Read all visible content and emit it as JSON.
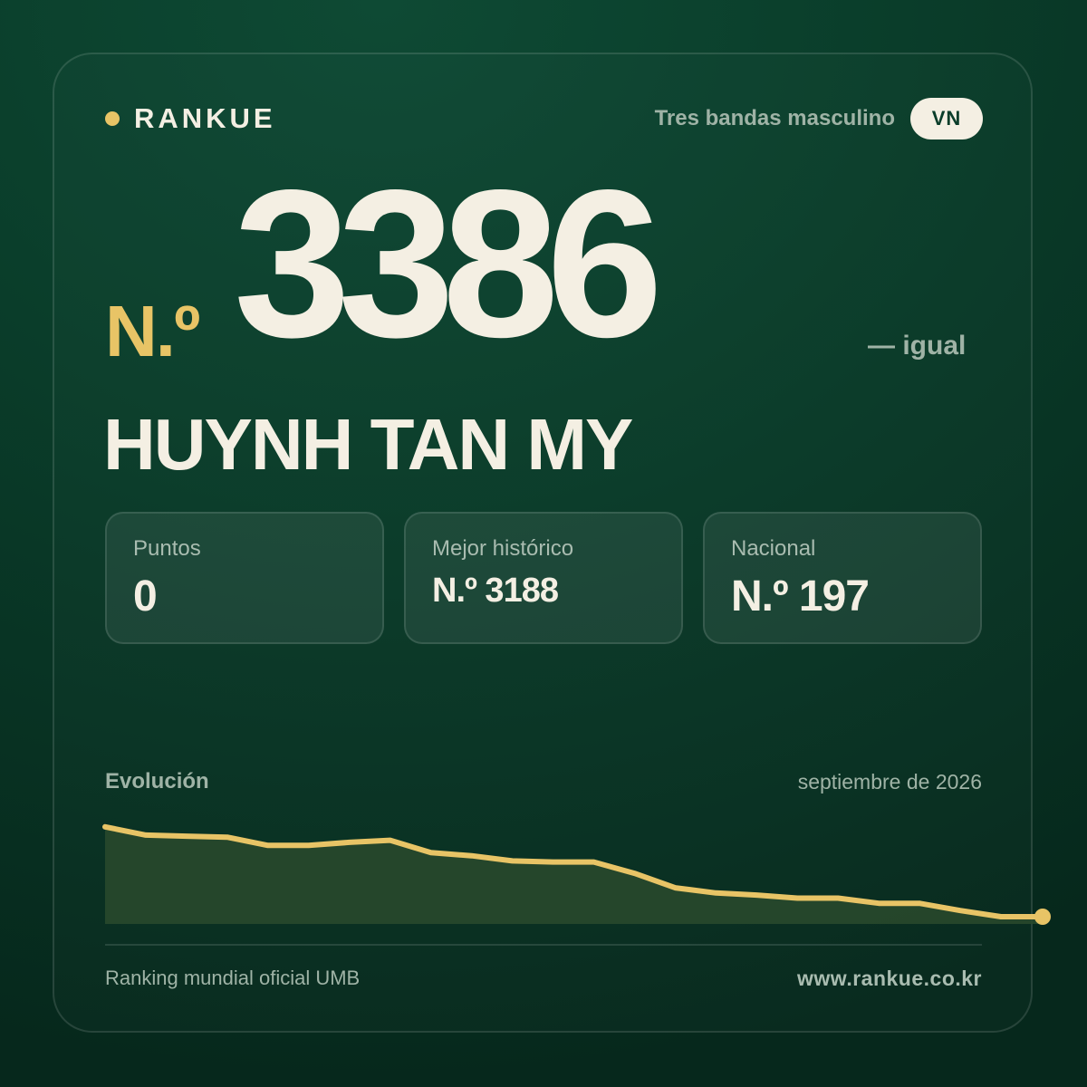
{
  "brand": {
    "name": "RANKUE"
  },
  "header": {
    "category": "Tres bandas masculino",
    "country_code": "VN"
  },
  "rank": {
    "prefix": "N.º",
    "number": "3386",
    "change": "— igual"
  },
  "player": {
    "name": "HUYNH TAN MY"
  },
  "stats": [
    {
      "label": "Puntos",
      "value": "0"
    },
    {
      "label": "Mejor histórico",
      "value": "N.º 3188"
    },
    {
      "label": "Nacional",
      "value": "N.º 197"
    }
  ],
  "evolution": {
    "label": "Evolución",
    "period": "septiembre de 2026"
  },
  "chart_data": {
    "type": "area",
    "values": [
      0.13,
      0.21,
      0.22,
      0.23,
      0.31,
      0.31,
      0.28,
      0.26,
      0.38,
      0.41,
      0.46,
      0.47,
      0.47,
      0.58,
      0.72,
      0.77,
      0.79,
      0.82,
      0.82,
      0.87,
      0.87,
      0.94,
      1.0,
      1.0
    ],
    "y_meaning": "relative rank level (higher = lower on chart)",
    "colors": {
      "line": "#e8c466",
      "fill": "#2a4a2d"
    }
  },
  "footer": {
    "source": "Ranking mundial oficial UMB",
    "website": "www.rankue.co.kr"
  }
}
